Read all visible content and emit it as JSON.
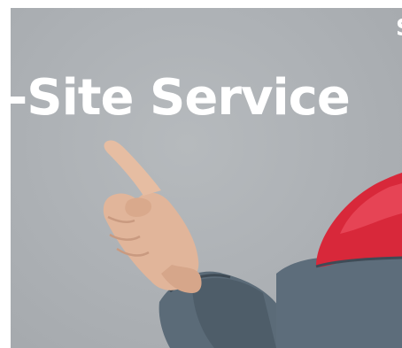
{
  "hero": {
    "title": "-Site Service",
    "corner_fragment": "S"
  },
  "colors": {
    "background": "#aeb2b6",
    "title": "#ffffff",
    "uniform_gray": "#5b6b78",
    "uniform_red": "#d8283a",
    "skin": "#e1b59a"
  },
  "icons": {
    "image": "person-pointing-photo"
  }
}
